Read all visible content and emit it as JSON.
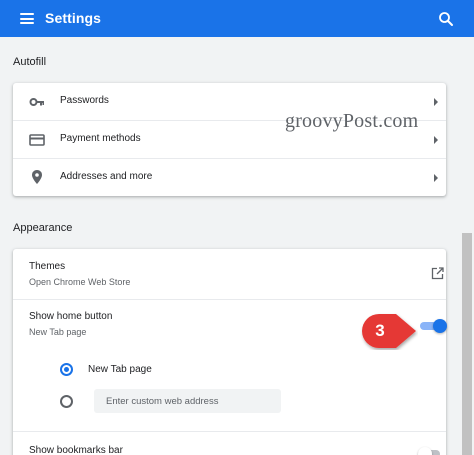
{
  "header": {
    "title": "Settings",
    "menu_icon": "hamburger-menu-icon",
    "search_icon": "search-icon",
    "color": "#1a73e8"
  },
  "autofill": {
    "title": "Autofill",
    "items": [
      {
        "label": "Passwords",
        "icon": "key-icon"
      },
      {
        "label": "Payment methods",
        "icon": "credit-card-icon"
      },
      {
        "label": "Addresses and more",
        "icon": "location-pin-icon"
      }
    ]
  },
  "appearance": {
    "title": "Appearance",
    "themes": {
      "title": "Themes",
      "subtitle": "Open Chrome Web Store",
      "icon": "open-in-new-icon"
    },
    "home_button": {
      "title": "Show home button",
      "subtitle": "New Tab page",
      "enabled": true
    },
    "radio_options": [
      {
        "label": "New Tab page",
        "selected": true
      },
      {
        "placeholder": "Enter custom web address",
        "value": "",
        "selected": false
      }
    ],
    "bookmarks_bar": {
      "title": "Show bookmarks bar"
    }
  },
  "watermark": "groovyPost.com",
  "annotation_badge": {
    "number": "3",
    "color": "#e53935"
  }
}
